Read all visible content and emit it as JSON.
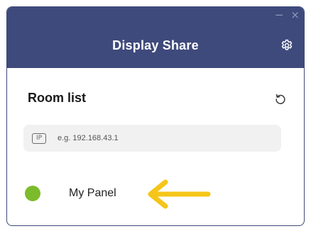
{
  "window": {
    "minimize_glyph": "−",
    "close_glyph": "×"
  },
  "header": {
    "title": "Display Share",
    "settings_icon": "gear-icon",
    "background": "#3f4a7c"
  },
  "room_list": {
    "title": "Room list",
    "refresh_icon": "refresh-icon"
  },
  "ip_input": {
    "badge": "IP",
    "placeholder": "e.g. 192.168.43.1",
    "value": ""
  },
  "rooms": [
    {
      "name": "My Panel",
      "status_color": "#7cbb2c"
    }
  ],
  "annotation": {
    "icon": "arrow-left-icon",
    "color": "#f5c51a"
  }
}
